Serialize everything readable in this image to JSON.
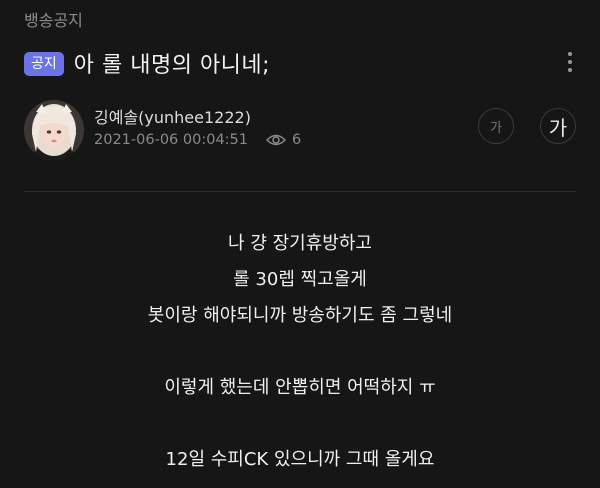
{
  "breadcrumb": "뱅송공지",
  "post": {
    "badge": "공지",
    "title": "아 롤 내명의 아니네;"
  },
  "author": {
    "name": "깅예솔(yunhee1222)",
    "datetime": "2021-06-06 00:04:51",
    "views": "6"
  },
  "font_controls": {
    "small": "가",
    "large": "가"
  },
  "content": {
    "lines": [
      "나 걍 장기휴방하고",
      "롤 30렙 찍고올게",
      "봇이랑 해야되니까 방송하기도 좀 그렇네",
      "",
      "이렇게 했는데 안뽑히면 어떡하지 ㅠ",
      "",
      "12일 수피CK 있으니까 그때 올게요"
    ]
  },
  "icons": {
    "more": "more-vertical-icon",
    "views": "eye-icon"
  },
  "colors": {
    "background": "#161616",
    "badge": "#6b73e6"
  }
}
